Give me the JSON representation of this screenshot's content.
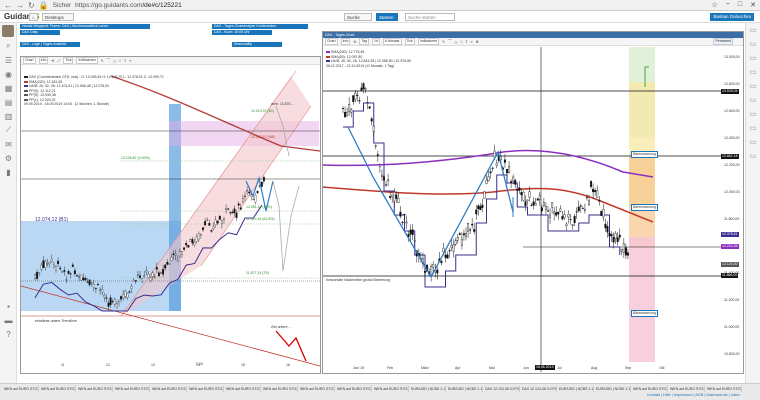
{
  "browser": {
    "secure_label": "Sicher",
    "url_prefix": "https://go.guidants.com",
    "url_path": "/de#c/125221"
  },
  "app": {
    "logo_a": "Guidant",
    "logo_b": "S",
    "buttons": {
      "desktops": "Desktops",
      "suche": "Suche",
      "starten": "Starten",
      "suche_starten": "Suche starten",
      "user": "Bastian Galuschka"
    }
  },
  "headlines": {
    "left": [
      "Harald Weygand: Frame: DAX | Wochenausblick Lorem",
      "DAX Daily",
      "DAX - Lage | Tages-Ausblick",
      "Seasonality"
    ],
    "right": [
      "DAX - Tages-Chartanalyse Kohlendaten",
      "DAX - Buch: 10:05 Uhr"
    ]
  },
  "left_chart": {
    "toolbar": [
      "Chart",
      "Info",
      "Tick",
      "Indikatoren"
    ],
    "legend": [
      {
        "text": "DAX (Commerzbank CFD, real) : O: 12.093,81 H: 12.103,70 L: 12.078,91 C: 12.099,71",
        "color": "#222"
      },
      {
        "text": "SMA(200): 12.181,95",
        "color": "#b43c3c"
      },
      {
        "text": "HA/B: 26, 52, 26: 12.101,91 | 12.066,48 | 12.076,92",
        "color": "#3a2f8f"
      },
      {
        "text": "PP(S): 12.112,21",
        "color": "#555"
      },
      {
        "text": "PP(S): 12.090,38",
        "color": "#555"
      },
      {
        "text": "PP(L): 12.023,22",
        "color": "#555"
      },
      {
        "text": "09.09.2019 - 16.09.2019 14:00 - (2 Wochen, 1 Stunde)",
        "color": "#555"
      }
    ],
    "annotations": {
      "ath": "12.210,37 (B1)",
      "a1": "12.180,10 (M8)",
      "a2": "12.106,87 (0.00%)",
      "a3": "12.051,14 (50%)",
      "a4": "11.949,16 (61.8%)",
      "a5": "11.877,15 (T5)",
      "level": "12.074,12 (B1)",
      "note1": "amrr. 11.876 ...",
      "note2": "erhaltene untere Trendlinie",
      "note3": "Ziel untere ..."
    },
    "x_labels": [
      "11",
      "12",
      "13",
      "14",
      "15",
      "16"
    ],
    "time_label": "7:00"
  },
  "right_chart": {
    "title": "DAX - Tages-Chart",
    "toolbar": [
      "Chart",
      "Info",
      "Tag",
      "1d",
      "6 Monate",
      "Tick",
      "Indikatoren"
    ],
    "legend": [
      {
        "text": "SMA(200): 12.776,45",
        "color": "#8b2fbf"
      },
      {
        "text": "SMA(50): 12.057,80",
        "color": "#c0392b"
      },
      {
        "text": "HA/B: 26, 52, 26: 12.843,28 | 12.085,80 | 12.976,80",
        "color": "#3a2f8f"
      },
      {
        "text": "06.12.2017 - 22.10.2019 (11 Monate, 1 Tag)",
        "color": "#333"
      }
    ],
    "price_axis": [
      "13.000,00",
      "12.800,00",
      "12.600,00",
      "12.400,00",
      "12.200,00",
      "12.000,00",
      "11.800,00",
      "11.600,00",
      "11.400,00",
      "11.200,00",
      "11.000,00",
      "10.800,00"
    ],
    "price_tags": [
      {
        "label": "13.535,05",
        "color": "#111"
      },
      {
        "label": "12.862,18",
        "color": "#111"
      },
      {
        "label": "12.378,51",
        "color": "#3a2f8f"
      },
      {
        "label": "12.224,36",
        "color": "#8b2fbf"
      },
      {
        "label": "12.124,30",
        "color": "#555"
      },
      {
        "label": "11.866,00",
        "color": "#111"
      }
    ],
    "x_labels": [
      "Jan '19",
      "Feb",
      "März",
      "Apr",
      "Mai",
      "Jun",
      "Jul",
      "Aug",
      "Sep",
      "Okt"
    ],
    "date_marker": "16.06.2019",
    "annotations": {
      "n1": "Bärenwarnung",
      "n2": "Bärenwarnung",
      "n3": "Bärenwarnung",
      "bottom": "horizontale Nackenlinie global Beziehung"
    },
    "persistent_label": "Persistent"
  },
  "bottom_tabs": [
    "WKN auf EURO STOXX 50",
    "WKN auf EURO STOXX 50",
    "WKN auf EURO STOXX 50",
    "WKN auf EURO STOXX 50",
    "WKN auf EURO STOXX 50",
    "WKN auf EURO STOXX 50",
    "WKN auf EURO STOXX 50",
    "WKN auf EURO STOXX 50",
    "WKN auf EURO STOXX 50",
    "WKN auf EURO STOXX 50",
    "WKN auf EURO STOXX 50",
    "EUR/USD | NCBS 1.10,4%",
    "EUR/USD | NCBS 1.10,4%",
    "DAX 12.124,36 0.07%",
    "DAX 12.124,36 0.07%",
    "EUR/USD | NCBS 1.10,4%",
    "EUR/USD | NCBS 1.10,4%",
    "WKN auf EURO STOXX 50",
    "WKN auf EURO STOXX 50",
    "WKN auf EURO STOXX 50"
  ],
  "footer": "Kontakt | Hilfe | Impressum | AGB | Datenschutz | Index",
  "colors": {
    "brand_blue": "#1b75bb",
    "candle_up": "#ffffff",
    "candle_down": "#111111",
    "sma200": "#8b2fbf",
    "sma50": "#c0392b",
    "ichimoku": "#3a2f8f",
    "trend_blue": "#2f7cc6"
  }
}
